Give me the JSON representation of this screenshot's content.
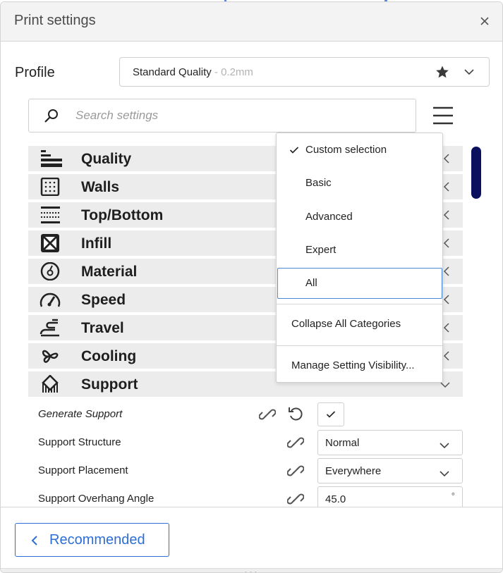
{
  "window": {
    "title": "Print settings"
  },
  "profile": {
    "label": "Profile",
    "selected_name": "Standard Quality",
    "selected_layer": " - 0.2mm"
  },
  "search": {
    "placeholder": "Search settings",
    "value": ""
  },
  "categories": [
    {
      "label": "Quality",
      "icon": "quality-icon"
    },
    {
      "label": "Walls",
      "icon": "walls-icon"
    },
    {
      "label": "Top/Bottom",
      "icon": "top-bottom-icon"
    },
    {
      "label": "Infill",
      "icon": "infill-icon"
    },
    {
      "label": "Material",
      "icon": "material-icon"
    },
    {
      "label": "Speed",
      "icon": "speed-icon"
    },
    {
      "label": "Travel",
      "icon": "travel-icon"
    },
    {
      "label": "Cooling",
      "icon": "cooling-icon"
    },
    {
      "label": "Support",
      "icon": "support-icon",
      "expanded": true
    }
  ],
  "support_settings": {
    "generate_support": {
      "label": "Generate Support",
      "checked": true
    },
    "structure": {
      "label": "Support Structure",
      "value": "Normal"
    },
    "placement": {
      "label": "Support Placement",
      "value": "Everywhere"
    },
    "overhang_angle": {
      "label": "Support Overhang Angle",
      "value": "45.0",
      "unit": "°"
    }
  },
  "visibility_menu": {
    "items": [
      {
        "label": "Custom selection",
        "checked": true
      },
      {
        "label": "Basic",
        "checked": false
      },
      {
        "label": "Advanced",
        "checked": false
      },
      {
        "label": "Expert",
        "checked": false
      },
      {
        "label": "All",
        "checked": false,
        "highlighted": true
      }
    ],
    "collapse_label": "Collapse All Categories",
    "manage_label": "Manage Setting Visibility..."
  },
  "footer": {
    "recommended_label": "Recommended"
  },
  "colors": {
    "accent": "#2c6ed6",
    "scrollbar": "#0a0f5e",
    "category_bg": "#ececec",
    "header_bg": "#f3f3f3"
  }
}
